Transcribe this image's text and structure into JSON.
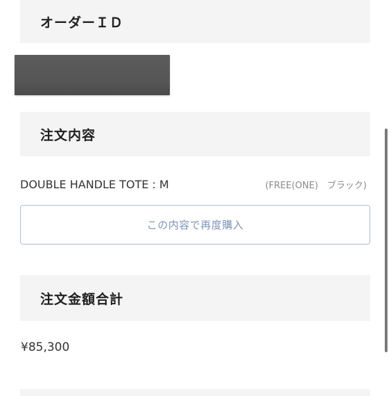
{
  "sections": {
    "order_id_header": "オーダーＩＤ",
    "order_contents_header": "注文内容",
    "order_total_header": "注文金額合計"
  },
  "order": {
    "item_name": "DOUBLE HANDLE TOTE : M",
    "item_variant": "(FREE(ONE)　ブラック)",
    "reorder_label": "この内容で再度購入",
    "total": "¥85,300"
  },
  "colors": {
    "section_bg": "#f4f4f4",
    "button_border": "#a9bdd6",
    "button_text": "#7c95b8",
    "redaction": "#555555"
  }
}
